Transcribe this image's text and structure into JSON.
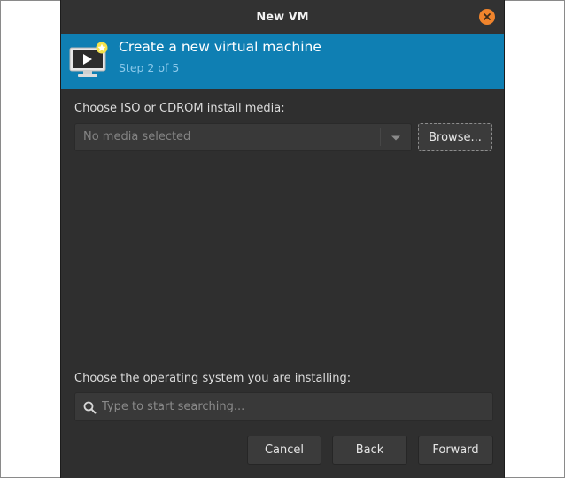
{
  "window": {
    "title": "New VM"
  },
  "header": {
    "title": "Create a new virtual machine",
    "step": "Step 2 of 5"
  },
  "install_media": {
    "label": "Choose ISO or CDROM install media:",
    "value": "No media selected",
    "browse_label": "Browse..."
  },
  "os": {
    "label": "Choose the operating system you are installing:",
    "search_placeholder": "Type to start searching..."
  },
  "buttons": {
    "cancel": "Cancel",
    "back": "Back",
    "forward": "Forward"
  },
  "colors": {
    "header_bg": "#0f7fb3",
    "close_button": "#f0842c",
    "window_bg": "#2f2f2f"
  },
  "icons": [
    "close-icon",
    "virtual-machine-icon",
    "dropdown-arrow-icon",
    "search-icon"
  ]
}
